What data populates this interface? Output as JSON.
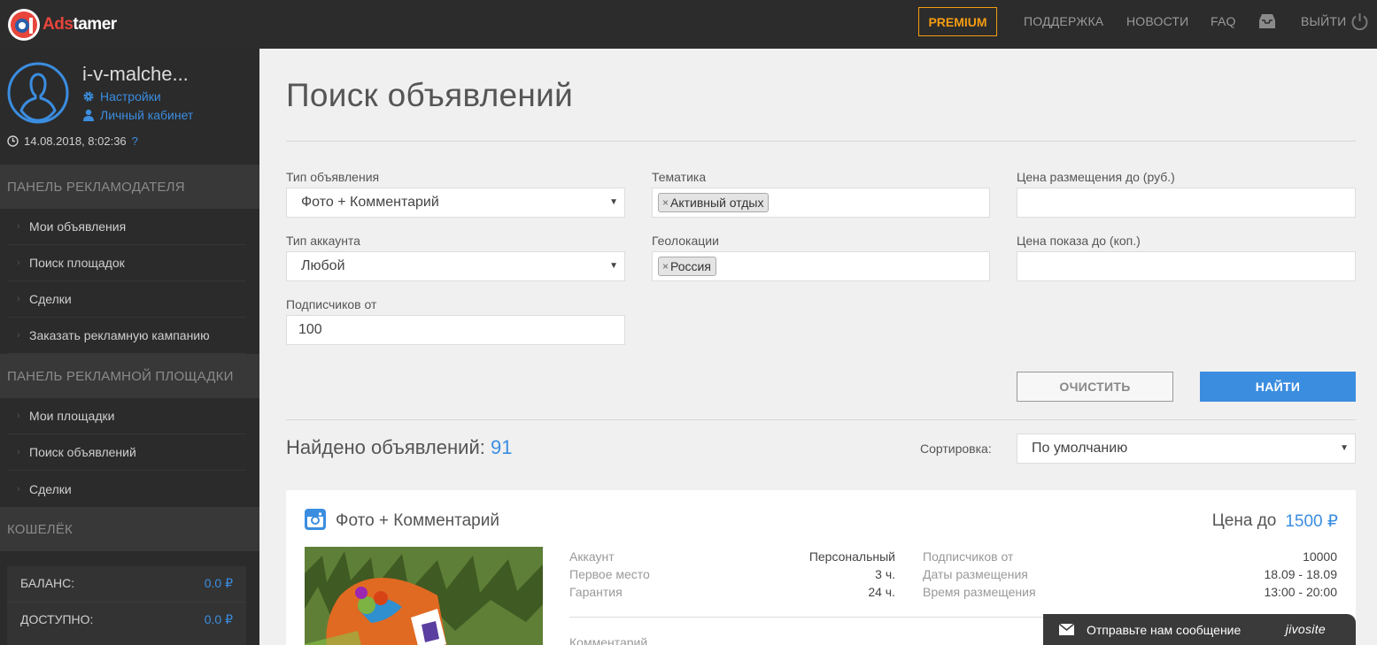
{
  "topbar": {
    "logo_part1": "Ads",
    "logo_part2": "tamer",
    "premium_label": "PREMIUM",
    "nav": [
      "ПОДДЕРЖКА",
      "НОВОСТИ",
      "FAQ"
    ],
    "logout_label": "ВЫЙТИ",
    "icons": {
      "inbox": "inbox-icon",
      "power": "power-icon"
    }
  },
  "sidebar": {
    "username": "i-v-malche...",
    "settings_link": "Настройки",
    "cabinet_link": "Личный кабинет",
    "datetime": "14.08.2018, 8:02:36",
    "help_mark": "?",
    "advertiser_panel": {
      "title": "ПАНЕЛЬ РЕКЛАМОДАТЕЛЯ",
      "items": [
        "Мои объявления",
        "Поиск площадок",
        "Сделки",
        "Заказать рекламную кампанию"
      ]
    },
    "platform_panel": {
      "title": "ПАНЕЛЬ РЕКЛАМНОЙ ПЛОЩАДКИ",
      "items": [
        "Мои площадки",
        "Поиск объявлений",
        "Сделки"
      ]
    },
    "wallet": {
      "title": "КОШЕЛЁК",
      "balance_label": "БАЛАНС:",
      "balance_value": "0.0 ₽",
      "available_label": "ДОСТУПНО:",
      "available_value": "0.0 ₽"
    }
  },
  "main": {
    "title": "Поиск объявлений",
    "filters": {
      "ad_type_label": "Тип объявления",
      "ad_type_value": "Фото + Комментарий",
      "theme_label": "Тематика",
      "theme_tag": "Активный отдых",
      "price_place_label": "Цена размещения до (руб.)",
      "price_place_value": "",
      "account_type_label": "Тип аккаунта",
      "account_type_value": "Любой",
      "geo_label": "Геолокации",
      "geo_tag": "Россия",
      "price_view_label": "Цена показа до (коп.)",
      "price_view_value": "",
      "subscribers_label": "Подписчиков от",
      "subscribers_value": "100",
      "tag_remove": "×"
    },
    "clear_button": "ОЧИСТИТЬ",
    "find_button": "НАЙТИ",
    "found_label": "Найдено объявлений:",
    "found_count": "91",
    "sort_label": "Сортировка:",
    "sort_value": "По умолчанию",
    "card": {
      "title": "Фото + Комментарий",
      "price_label": "Цена до",
      "price_value": "1500 ₽",
      "left": [
        {
          "label": "Аккаунт",
          "value": "Персональный"
        },
        {
          "label": "Первое место",
          "value": "3 ч."
        },
        {
          "label": "Гарантия",
          "value": "24 ч."
        }
      ],
      "right": [
        {
          "label": "Подписчиков от",
          "value": "10000"
        },
        {
          "label": "Даты размещения",
          "value": "18.09 - 18.09"
        },
        {
          "label": "Время размещения",
          "value": "13:00 - 20:00"
        }
      ],
      "comment_label": "Комментарий"
    }
  },
  "jivo": {
    "message": "Отправьте нам сообщение",
    "brand": "jivosite"
  },
  "colors": {
    "accent": "#3b8de0",
    "premium": "#f39c12",
    "sidebar_bg": "#2b2b2b",
    "topbar_bg": "#2c2c2c"
  }
}
